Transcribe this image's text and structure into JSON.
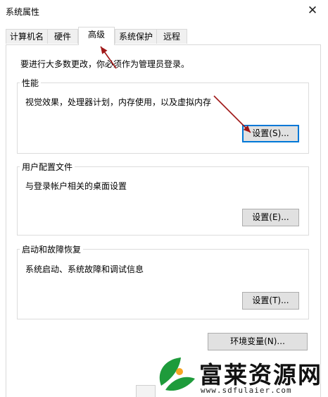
{
  "window": {
    "title": "系统属性",
    "close_glyph": "✕"
  },
  "tabs": [
    {
      "label": "计算机名",
      "active": false
    },
    {
      "label": "硬件",
      "active": false
    },
    {
      "label": "高级",
      "active": true
    },
    {
      "label": "系统保护",
      "active": false
    },
    {
      "label": "远程",
      "active": false
    }
  ],
  "advanced": {
    "notice": "要进行大多数更改，你必须作为管理员登录。",
    "performance": {
      "title": "性能",
      "description": "视觉效果，处理器计划，内存使用，以及虚拟内存",
      "button": "设置(S)..."
    },
    "user_profiles": {
      "title": "用户配置文件",
      "description": "与登录帐户相关的桌面设置",
      "button": "设置(E)..."
    },
    "startup_recovery": {
      "title": "启动和故障恢复",
      "description": "系统启动、系统故障和调试信息",
      "button": "设置(T)..."
    },
    "env_button": "环境变量(N)..."
  },
  "watermark": {
    "title": "富莱资源网",
    "url": "www.sdfulaier.com",
    "logo_colors": [
      "#1e9b3b",
      "#f5a623"
    ]
  },
  "colors": {
    "annotation_arrow": "#a01818",
    "focus_border": "#0078d7"
  }
}
